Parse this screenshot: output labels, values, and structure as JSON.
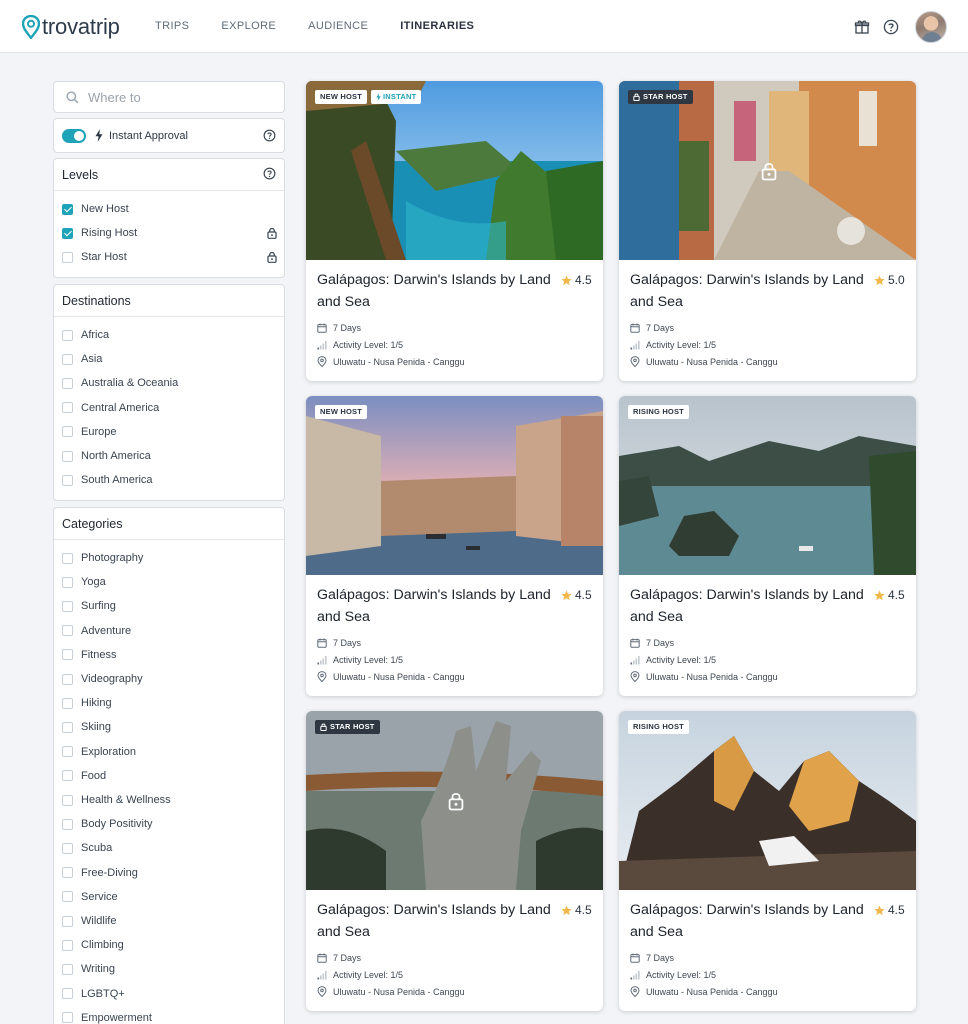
{
  "header": {
    "logo_text": "trovatrip",
    "nav": [
      {
        "label": "TRIPS",
        "active": false
      },
      {
        "label": "EXPLORE",
        "active": false
      },
      {
        "label": "AUDIENCE",
        "active": false
      },
      {
        "label": "ITINERARIES",
        "active": true
      }
    ],
    "icons": [
      "gift-icon",
      "help-icon",
      "avatar"
    ]
  },
  "sidebar": {
    "search_placeholder": "Where to",
    "instant_approval": {
      "label": "Instant Approval",
      "enabled": true
    },
    "levels": {
      "title": "Levels",
      "items": [
        {
          "label": "New Host",
          "checked": true,
          "locked": false
        },
        {
          "label": "Rising Host",
          "checked": true,
          "locked": true
        },
        {
          "label": "Star Host",
          "checked": false,
          "locked": true
        }
      ]
    },
    "destinations": {
      "title": "Destinations",
      "items": [
        "Africa",
        "Asia",
        "Australia & Oceania",
        "Central America",
        "Europe",
        "North America",
        "South America"
      ]
    },
    "categories": {
      "title": "Categories",
      "items": [
        "Photography",
        "Yoga",
        "Surfing",
        "Adventure",
        "Fitness",
        "Videography",
        "Hiking",
        "Skiing",
        "Exploration",
        "Food",
        "Health & Wellness",
        "Body Positivity",
        "Scuba",
        "Free-Diving",
        "Service",
        "Wildlife",
        "Climbing",
        "Writing",
        "LGBTQ+",
        "Empowerment"
      ]
    }
  },
  "cards": [
    {
      "badges": [
        "NEW HOST",
        "INSTANT"
      ],
      "locked": false,
      "title": "Galápagos: Darwin's Islands by Land and Sea",
      "rating": "4.5",
      "days": "7 Days",
      "activity": "Activity Level: 1/5",
      "route": "Uluwatu - Nusa Penida - Canggu",
      "scene": "tropical-cliffs"
    },
    {
      "badges": [
        "STAR HOST"
      ],
      "locked": true,
      "title": "Galápagos: Darwin's Islands by Land and Sea",
      "rating": "5.0",
      "days": "7 Days",
      "activity": "Activity Level: 1/5",
      "route": "Uluwatu - Nusa Penida - Canggu",
      "scene": "village-alley"
    },
    {
      "badges": [
        "NEW HOST"
      ],
      "locked": false,
      "title": "Galápagos: Darwin's Islands by Land and Sea",
      "rating": "4.5",
      "days": "7 Days",
      "activity": "Activity Level: 1/5",
      "route": "Uluwatu - Nusa Penida - Canggu",
      "scene": "venice-canal"
    },
    {
      "badges": [
        "RISING HOST"
      ],
      "locked": false,
      "title": "Galápagos: Darwin's Islands by Land and Sea",
      "rating": "4.5",
      "days": "7 Days",
      "activity": "Activity Level: 1/5",
      "route": "Uluwatu - Nusa Penida - Canggu",
      "scene": "ha-long-bay"
    },
    {
      "badges": [
        "STAR HOST"
      ],
      "locked": true,
      "title": "Galápagos: Darwin's Islands by Land and Sea",
      "rating": "4.5",
      "days": "7 Days",
      "activity": "Activity Level: 1/5",
      "route": "Uluwatu - Nusa Penida - Canggu",
      "scene": "golden-bridge"
    },
    {
      "badges": [
        "RISING HOST"
      ],
      "locked": false,
      "title": "Galápagos: Darwin's Islands by Land and Sea",
      "rating": "4.5",
      "days": "7 Days",
      "activity": "Activity Level: 1/5",
      "route": "Uluwatu - Nusa Penida - Canggu",
      "scene": "mountain-peaks"
    }
  ],
  "colors": {
    "accent": "#1fa3b8",
    "star": "#f2b84b",
    "badge_dark": "#2e3742"
  }
}
